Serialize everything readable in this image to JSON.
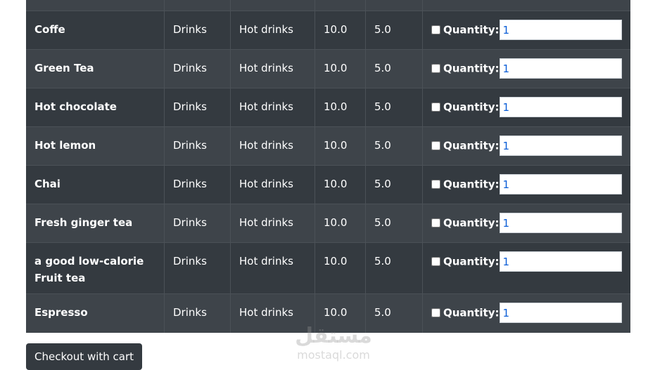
{
  "rows": [
    {
      "name": "",
      "category": "",
      "subcategory": "",
      "price": "",
      "discount": "",
      "quantity": ""
    },
    {
      "name": "Coffe",
      "category": "Drinks",
      "subcategory": "Hot drinks",
      "price": "10.0",
      "discount": "5.0",
      "quantity_label": "Quantity:",
      "quantity": "1"
    },
    {
      "name": "Green Tea",
      "category": "Drinks",
      "subcategory": "Hot drinks",
      "price": "10.0",
      "discount": "5.0",
      "quantity_label": "Quantity:",
      "quantity": "1"
    },
    {
      "name": "Hot chocolate",
      "category": "Drinks",
      "subcategory": "Hot drinks",
      "price": "10.0",
      "discount": "5.0",
      "quantity_label": "Quantity:",
      "quantity": "1"
    },
    {
      "name": "Hot lemon",
      "category": "Drinks",
      "subcategory": "Hot drinks",
      "price": "10.0",
      "discount": "5.0",
      "quantity_label": "Quantity:",
      "quantity": "1"
    },
    {
      "name": "Chai",
      "category": "Drinks",
      "subcategory": "Hot drinks",
      "price": "10.0",
      "discount": "5.0",
      "quantity_label": "Quantity:",
      "quantity": "1"
    },
    {
      "name": "Fresh ginger tea",
      "category": "Drinks",
      "subcategory": "Hot drinks",
      "price": "10.0",
      "discount": "5.0",
      "quantity_label": "Quantity:",
      "quantity": "1"
    },
    {
      "name": "a good low-calorie Fruit tea",
      "category": "Drinks",
      "subcategory": "Hot drinks",
      "price": "10.0",
      "discount": "5.0",
      "quantity_label": "Quantity:",
      "quantity": "1"
    },
    {
      "name": "Espresso",
      "category": "Drinks",
      "subcategory": "Hot drinks",
      "price": "10.0",
      "discount": "5.0",
      "quantity_label": "Quantity:",
      "quantity": "1"
    }
  ],
  "checkout_label": "Checkout with cart",
  "watermark": {
    "arabic": "مستقل",
    "latin": "mostaql.com"
  }
}
